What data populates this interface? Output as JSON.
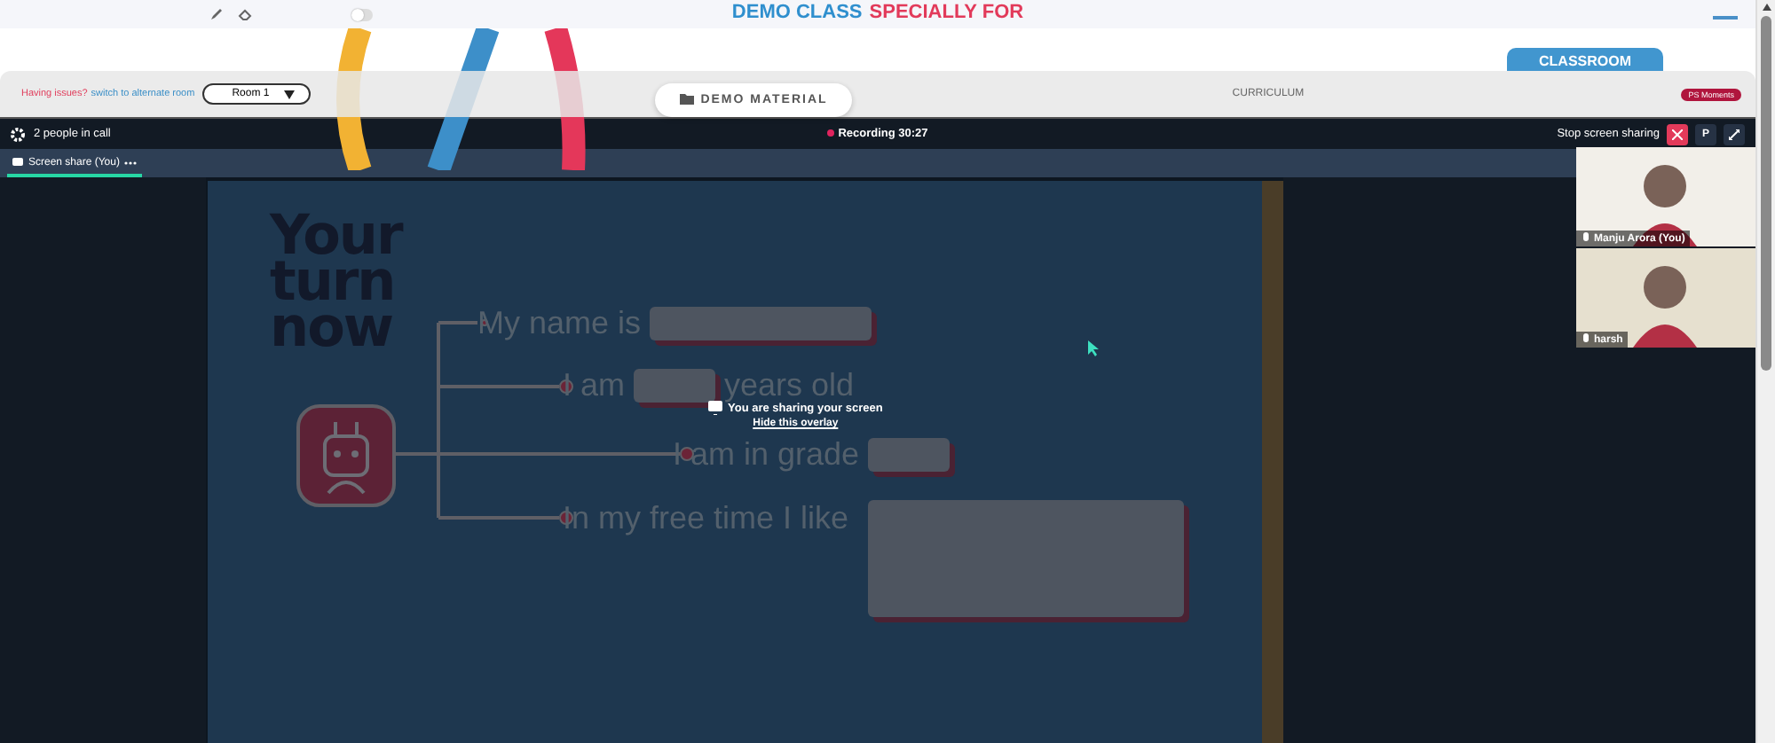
{
  "header": {
    "title_part1": "DEMO CLASS",
    "title_part2": "SPECIALLY FOR",
    "toggle_on": false
  },
  "toolbar": {
    "issue_text": "Having issues?",
    "switch_link": "switch to alternate room",
    "room_select": "Room 1",
    "demo_material": "DEMO MATERIAL",
    "curriculum": "CURRICULUM",
    "classroom": "CLASSROOM",
    "moments": "PS Moments"
  },
  "call": {
    "people": "2 people in call",
    "recording": "Recording 30:27",
    "stop_sharing": "Stop screen sharing",
    "p_button": "P",
    "tabs": [
      {
        "label": "Screen share (You)",
        "selected": true
      }
    ]
  },
  "slide": {
    "heading": "Your turn now",
    "prompts": [
      {
        "kind": "inline",
        "before": "My name is"
      },
      {
        "kind": "inline",
        "before": "I am",
        "after": "years old"
      },
      {
        "kind": "inline",
        "before": "I am in grade"
      },
      {
        "kind": "large",
        "before": "In my free time I like"
      }
    ]
  },
  "overlay": {
    "message": "You are sharing your screen",
    "hide_link": "Hide this overlay"
  },
  "participants": [
    {
      "name": "Manju Arora (You)"
    },
    {
      "name": "harsh"
    }
  ]
}
